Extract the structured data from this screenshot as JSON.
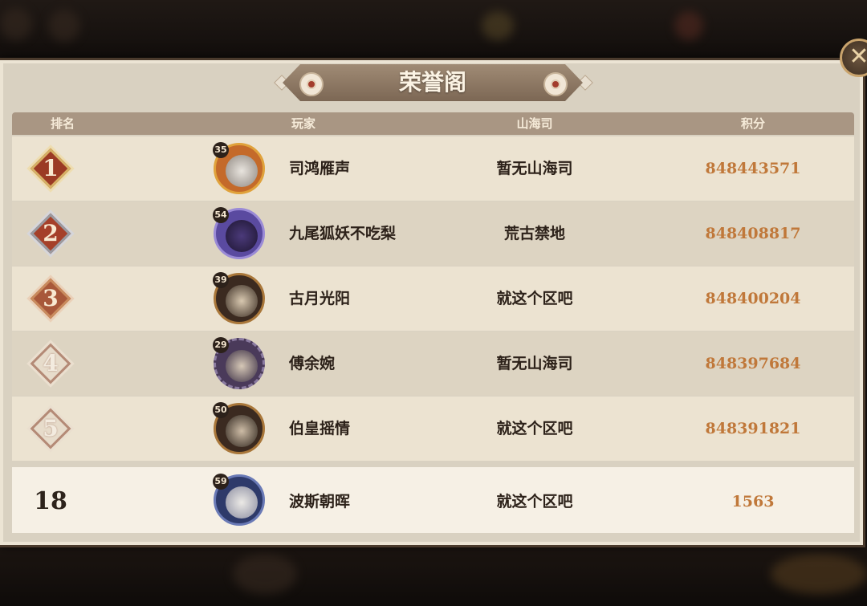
{
  "title": "荣誉阁",
  "close_icon": "close-icon",
  "columns": {
    "rank": "排名",
    "player": "玩家",
    "guild": "山海司",
    "score": "积分"
  },
  "rows": [
    {
      "rank": "1",
      "level": "35",
      "name": "司鸿雁声",
      "guild": "暂无山海司",
      "score": "848443571",
      "badge": "gold"
    },
    {
      "rank": "2",
      "level": "54",
      "name": "九尾狐妖不吃梨",
      "guild": "荒古禁地",
      "score": "848408817",
      "badge": "silver"
    },
    {
      "rank": "3",
      "level": "39",
      "name": "古月光阳",
      "guild": "就这个区吧",
      "score": "848400204",
      "badge": "bronze"
    },
    {
      "rank": "4",
      "level": "29",
      "name": "傅余婉",
      "guild": "暂无山海司",
      "score": "848397684",
      "badge": "plain"
    },
    {
      "rank": "5",
      "level": "50",
      "name": "伯皇摇情",
      "guild": "就这个区吧",
      "score": "848391821",
      "badge": "plain"
    }
  ],
  "my_row": {
    "rank": "18",
    "level": "59",
    "name": "波斯朝晖",
    "guild": "就这个区吧",
    "score": "1563"
  },
  "colors": {
    "score": "#c0783a",
    "gold": "#c8a050",
    "silver": "#8a8a8f",
    "bronze": "#a8583a"
  }
}
